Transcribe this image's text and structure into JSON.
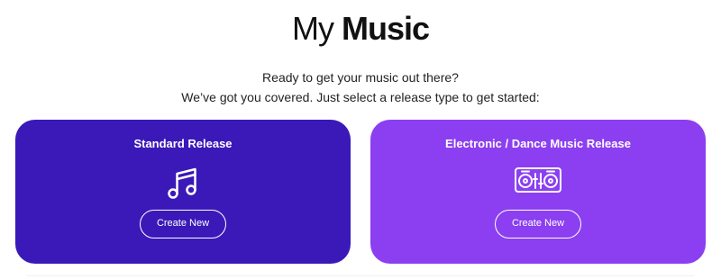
{
  "header": {
    "title_light": "My",
    "title_bold": "Music"
  },
  "intro": {
    "line1": "Ready to get your music out there?",
    "line2": "We’ve got you covered. Just select a release type to get started:"
  },
  "cards": [
    {
      "title": "Standard Release",
      "icon": "music-note-icon",
      "button_label": "Create New",
      "color": "#3a19b8"
    },
    {
      "title": "Electronic / Dance Music Release",
      "icon": "dj-turntable-icon",
      "button_label": "Create New",
      "color": "#8b3ff0"
    }
  ]
}
